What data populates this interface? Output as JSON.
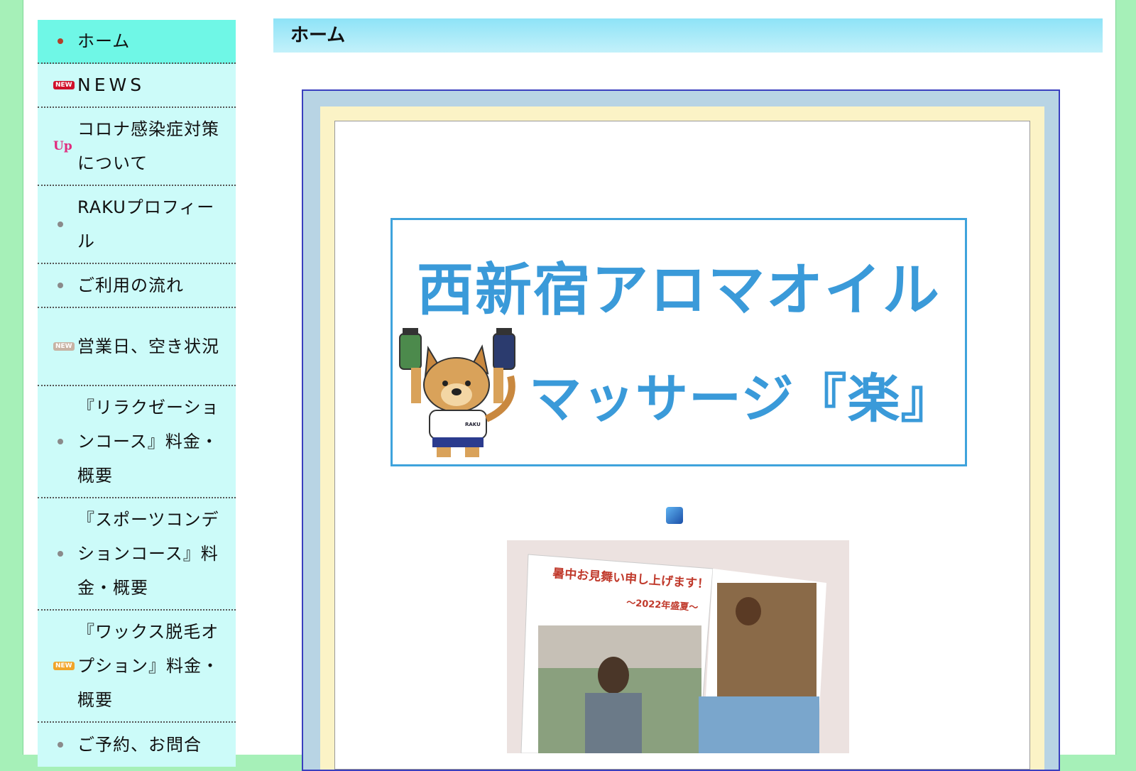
{
  "sidebar": {
    "items": [
      {
        "label": "ホーム",
        "icon": "bullet-dot-icon"
      },
      {
        "label": "NEWS",
        "icon": "new-badge-icon",
        "badge": "NEW"
      },
      {
        "label": "コロナ感染症対策について",
        "icon": "up-badge-icon",
        "badge": "Up"
      },
      {
        "label": "RAKUプロフィール",
        "icon": "bullet-dot-icon"
      },
      {
        "label": "ご利用の流れ",
        "icon": "bullet-dot-icon"
      },
      {
        "label": "営業日、空き状況",
        "icon": "new-badge-icon",
        "badge": "NEW"
      },
      {
        "label": "『リラクゼーションコース』料金・概要",
        "icon": "bullet-dot-icon"
      },
      {
        "label": "『スポーツコンデションコース』料金・概要",
        "icon": "bullet-dot-icon"
      },
      {
        "label": "『ワックス脱毛オプション』料金・概要",
        "icon": "new-badge-icon",
        "badge": "NEW"
      },
      {
        "label": "ご予約、お問合",
        "icon": "bullet-dot-icon"
      }
    ]
  },
  "main": {
    "title": "ホーム",
    "banner": {
      "line1": "西新宿アロマオイル",
      "line2": "マッサージ『楽』",
      "mascot_shirt_text": "RAKU"
    },
    "photo": {
      "caption_main": "暑中お見舞い申し上げます！",
      "caption_sub": "〜2022年盛夏〜"
    }
  },
  "colors": {
    "background": "#a6f0b8",
    "sidebar": "#ccfbf9",
    "sidebar_active": "#6ff7e6",
    "title_bar": "#8ee3f7",
    "banner_text": "#3a9ad9"
  }
}
